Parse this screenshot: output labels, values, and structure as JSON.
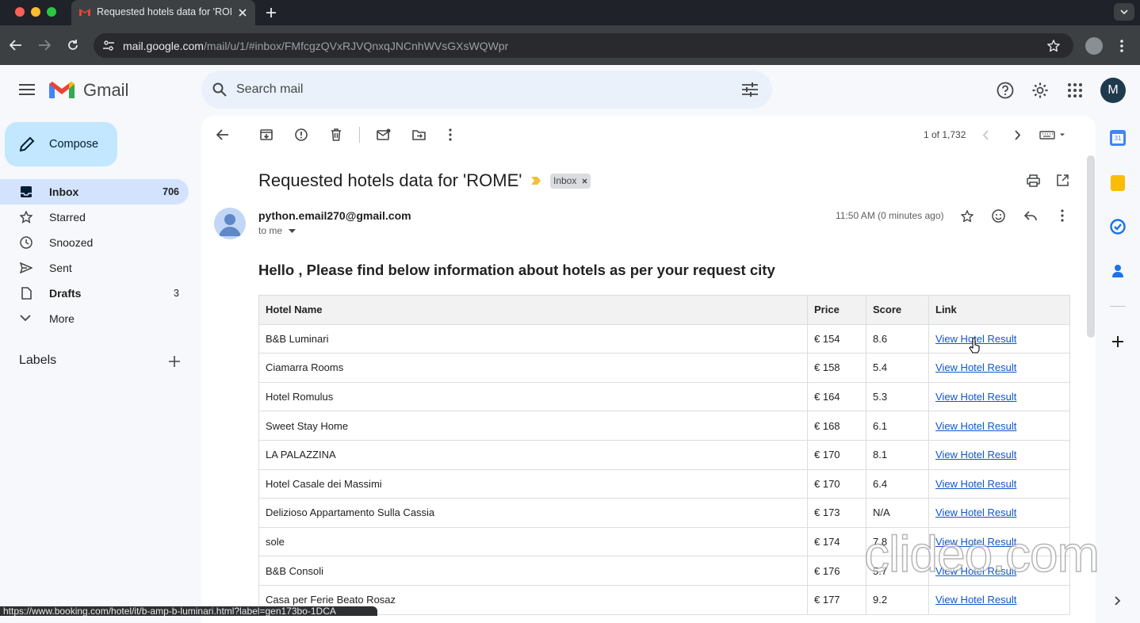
{
  "browser": {
    "tab_title": "Requested hotels data for 'ROME'",
    "url_host": "mail.google.com",
    "url_path": "/mail/u/1/#inbox/FMfcgzQVxRJVQnxqJNCnhWVsGXsWQWpr",
    "status_url": "https://www.booking.com/hotel/it/b-amp-b-luminari.html?label=gen173bo-1DCA"
  },
  "header": {
    "brand": "Gmail",
    "search_placeholder": "Search mail",
    "avatar_letter": "M"
  },
  "sidebar": {
    "compose_label": "Compose",
    "items": [
      {
        "label": "Inbox",
        "count": "706",
        "icon": "inbox-icon"
      },
      {
        "label": "Starred",
        "count": "",
        "icon": "star-icon"
      },
      {
        "label": "Snoozed",
        "count": "",
        "icon": "clock-icon"
      },
      {
        "label": "Sent",
        "count": "",
        "icon": "send-icon"
      },
      {
        "label": "Drafts",
        "count": "3",
        "icon": "draft-icon"
      },
      {
        "label": "More",
        "count": "",
        "icon": "chevron-down-icon"
      }
    ],
    "labels_title": "Labels"
  },
  "toolbar": {
    "pager": "1 of 1,732"
  },
  "message": {
    "subject": "Requested hotels data for 'ROME'",
    "label_chip": "Inbox",
    "sender": "python.email270@gmail.com",
    "recipient": "to me",
    "time": "11:50 AM (0 minutes ago)",
    "greeting": "Hello , Please find below information about hotels as per your request city",
    "table_headers": [
      "Hotel Name",
      "Price",
      "Score",
      "Link"
    ],
    "rows": [
      {
        "name": "B&B Luminari",
        "price": "€ 154",
        "score": "8.6",
        "link": "View Hotel Result"
      },
      {
        "name": "Ciamarra Rooms",
        "price": "€ 158",
        "score": "5.4",
        "link": "View Hotel Result"
      },
      {
        "name": "Hotel Romulus",
        "price": "€ 164",
        "score": "5.3",
        "link": "View Hotel Result"
      },
      {
        "name": "Sweet Stay Home",
        "price": "€ 168",
        "score": "6.1",
        "link": "View Hotel Result"
      },
      {
        "name": "LA PALAZZINA",
        "price": "€ 170",
        "score": "8.1",
        "link": "View Hotel Result"
      },
      {
        "name": "Hotel Casale dei Massimi",
        "price": "€ 170",
        "score": "6.4",
        "link": "View Hotel Result"
      },
      {
        "name": "Delizioso Appartamento Sulla Cassia",
        "price": "€ 173",
        "score": "N/A",
        "link": "View Hotel Result"
      },
      {
        "name": "sole",
        "price": "€ 174",
        "score": "7.8",
        "link": "View Hotel Result"
      },
      {
        "name": "B&B Consoli",
        "price": "€ 176",
        "score": "5.7",
        "link": "View Hotel Result"
      },
      {
        "name": "Casa per Ferie Beato Rosaz",
        "price": "€ 177",
        "score": "9.2",
        "link": "View Hotel Result"
      }
    ]
  },
  "watermark": "clideo.com",
  "colors": {
    "accent": "#0b57d0",
    "compose_bg": "#c2e7ff",
    "active_nav": "#d3e3fd",
    "link": "#1155cc"
  }
}
